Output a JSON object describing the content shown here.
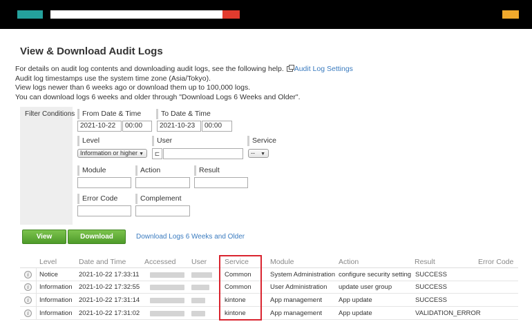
{
  "colors": {
    "topbar": "#000000",
    "logo": "#24a19c",
    "search_button": "#e23b2e",
    "user_mark": "#f0a92c",
    "accent_link": "#3a7bbf",
    "highlight_frame": "#d9232e",
    "button_green": "#5aa832"
  },
  "page_title": "View & Download Audit Logs",
  "description": {
    "line1_prefix": "For details on audit log contents and downloading audit logs, see the following help.",
    "line1_link": "Audit Log Settings",
    "line2": "Audit log timestamps use the system time zone (Asia/Tokyo).",
    "line3": "View logs newer than 6 weeks ago or download them up to 100,000 logs.",
    "line4": "You can download logs 6 weeks and older through \"Download Logs 6 Weeks and Older\"."
  },
  "filters": {
    "title": "Filter Conditions",
    "from_label": "From Date & Time",
    "from_date": "2021-10-22",
    "from_time": "00:00",
    "to_label": "To Date & Time",
    "to_date": "2021-10-23",
    "to_time": "00:00",
    "level_label": "Level",
    "level_value": "Information or higher",
    "user_label": "User",
    "user_value": "",
    "service_label": "Service",
    "service_value": "--",
    "module_label": "Module",
    "action_label": "Action",
    "result_label": "Result",
    "error_code_label": "Error Code",
    "complement_label": "Complement"
  },
  "buttons": {
    "view": "View",
    "download": "Download",
    "download_old": "Download Logs 6 Weeks and Older"
  },
  "table": {
    "headers": {
      "level": "Level",
      "datetime": "Date and Time",
      "accessed": "Accessed",
      "user": "User",
      "service": "Service",
      "module": "Module",
      "action": "Action",
      "result": "Result",
      "error_code": "Error Code"
    },
    "rows": [
      {
        "level": "Notice",
        "datetime": "2021-10-22 17:33:11",
        "service": "Common",
        "module": "System Administration",
        "action": "configure security setting",
        "result": "SUCCESS"
      },
      {
        "level": "Information",
        "datetime": "2021-10-22 17:32:55",
        "service": "Common",
        "module": "User Administration",
        "action": "update user group",
        "result": "SUCCESS"
      },
      {
        "level": "Information",
        "datetime": "2021-10-22 17:31:14",
        "service": "kintone",
        "module": "App management",
        "action": "App update",
        "result": "SUCCESS"
      },
      {
        "level": "Information",
        "datetime": "2021-10-22 17:31:02",
        "service": "kintone",
        "module": "App management",
        "action": "App update",
        "result": "VALIDATION_ERROR"
      }
    ]
  }
}
